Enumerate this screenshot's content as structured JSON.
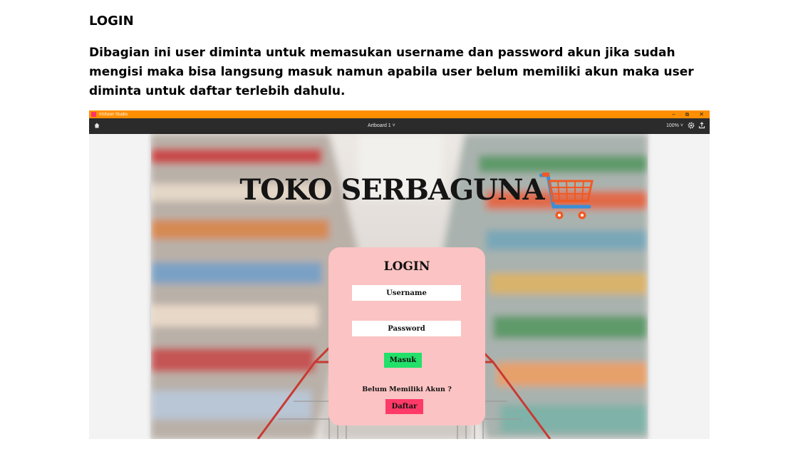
{
  "document": {
    "heading": "LOGIN",
    "paragraph": "Dibagian ini user diminta untuk memasukan username dan password akun jika sudah mengisi maka bisa langsung masuk namun apabila user belum memiliki akun  maka user diminta untuk daftar terlebih dahulu."
  },
  "app_window": {
    "title": "InVision Studio",
    "controls": {
      "minimize": "–",
      "restore": "⧉",
      "close": "✕"
    },
    "toolbar": {
      "home_icon": "home-icon",
      "artboard": "Artboard 1 ˅",
      "zoom": "100% ˅",
      "settings_icon": "gear-icon",
      "share_icon": "upload-icon"
    },
    "accent_color": "#ff8f00"
  },
  "artboard": {
    "brand_title": "TOKO SERBAGUNA",
    "brand_icon": "shopping-cart-icon",
    "login_card": {
      "title": "LOGIN",
      "username_placeholder": "Username",
      "password_placeholder": "Password",
      "submit_label": "Masuk",
      "no_account_text": "Belum Memiliki Akun ?",
      "register_label": "Daftar",
      "card_color": "#fbc3c3",
      "submit_color": "#22e06a",
      "register_color": "#ff3a68"
    }
  }
}
